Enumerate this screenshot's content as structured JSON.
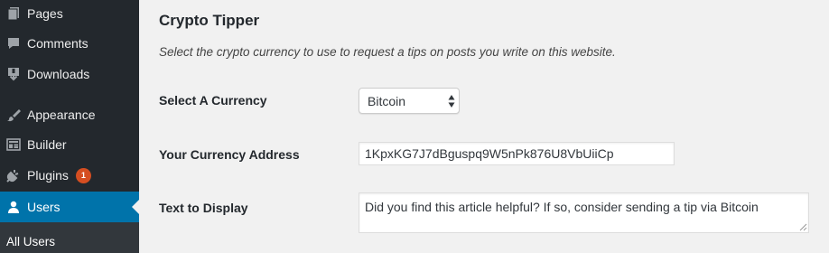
{
  "sidebar": {
    "items": [
      {
        "label": "Pages",
        "icon": "pages-icon"
      },
      {
        "label": "Comments",
        "icon": "comments-icon"
      },
      {
        "label": "Downloads",
        "icon": "downloads-icon"
      },
      {
        "label": "Appearance",
        "icon": "appearance-icon"
      },
      {
        "label": "Builder",
        "icon": "builder-icon"
      },
      {
        "label": "Plugins",
        "icon": "plugins-icon",
        "badge": "1"
      },
      {
        "label": "Users",
        "icon": "users-icon",
        "active": true
      }
    ],
    "submenu": {
      "label": "All Users"
    }
  },
  "main": {
    "title": "Crypto Tipper",
    "description": "Select the crypto currency to use to request a tips on posts you write on this website.",
    "fields": {
      "currency": {
        "label": "Select A Currency",
        "value": "Bitcoin"
      },
      "address": {
        "label": "Your Currency Address",
        "value": "1KpxKG7J7dBguspq9W5nPk876U8VbUiiCp"
      },
      "display_text": {
        "label": "Text to Display",
        "value": "Did you find this article helpful? If so, consider sending a tip via Bitcoin"
      }
    }
  },
  "colors": {
    "sidebar_bg": "#23282d",
    "active_bg": "#0073aa",
    "badge_bg": "#d54e21",
    "content_bg": "#f1f1f1"
  }
}
